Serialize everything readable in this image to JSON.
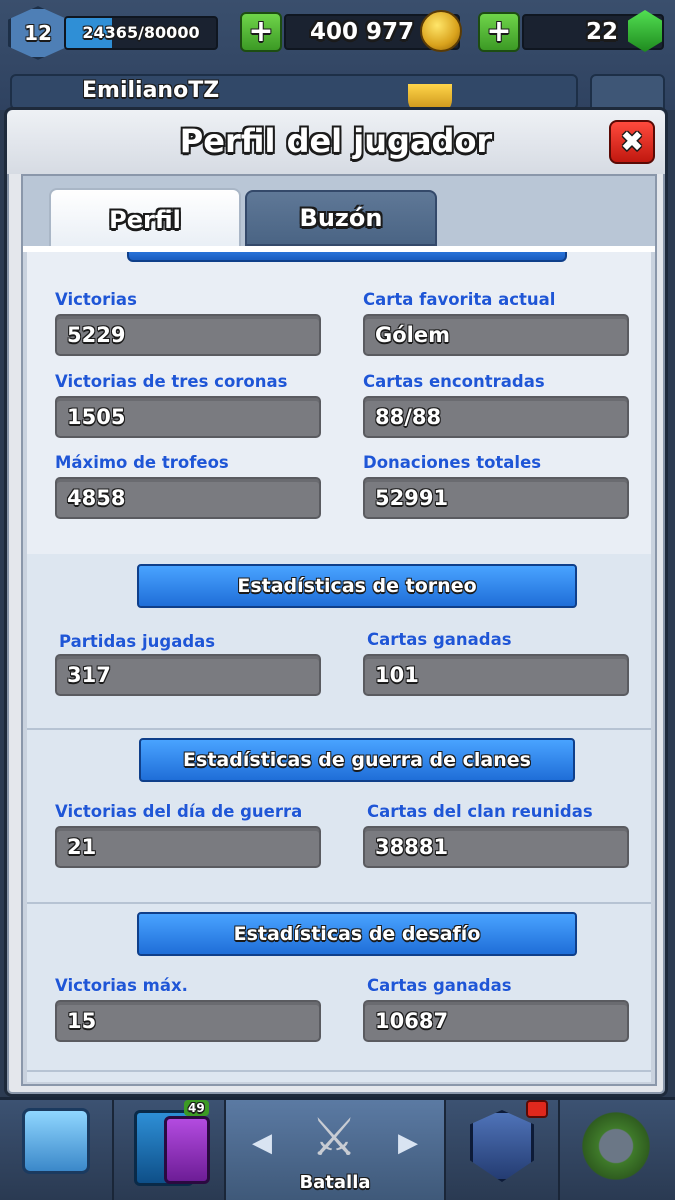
{
  "hud": {
    "level": "12",
    "xp": "24365/80000",
    "xp_progress": 0.3046,
    "gold": "400 977",
    "gems": "22",
    "player_name": "EmilianoTZ"
  },
  "modal": {
    "title": "Perfil del jugador",
    "close": "✖",
    "tabs": [
      "Perfil",
      "Buzón"
    ]
  },
  "profile_stats": [
    {
      "label": "Victorias",
      "value": "5229"
    },
    {
      "label": "Carta favorita actual",
      "value": "Gólem"
    },
    {
      "label": "Victorias de tres coronas",
      "value": "1505"
    },
    {
      "label": "Cartas encontradas",
      "value": "88/88"
    },
    {
      "label": "Máximo de trofeos",
      "value": "4858"
    },
    {
      "label": "Donaciones totales",
      "value": "52991"
    }
  ],
  "tournament": {
    "title": "Estadísticas de torneo",
    "stats": [
      {
        "label": "Partidas jugadas",
        "value": "317"
      },
      {
        "label": "Cartas ganadas",
        "value": "101"
      }
    ]
  },
  "clan_war": {
    "title": "Estadísticas de guerra de clanes",
    "stats": [
      {
        "label": "Victorias del día de guerra",
        "value": "21"
      },
      {
        "label": "Cartas del clan reunidas",
        "value": "38881"
      }
    ]
  },
  "challenge": {
    "title": "Estadísticas de desafío",
    "stats": [
      {
        "label": "Victorias máx.",
        "value": "15"
      },
      {
        "label": "Cartas ganadas",
        "value": "10687"
      }
    ]
  },
  "nav": {
    "battle_label": "Batalla",
    "cards_badge": "49"
  },
  "colors": {
    "stat_label": "#1f56d6",
    "stat_box": "#7a7b80",
    "banner": "#2f7ee6",
    "plus_button": "#4fbf32",
    "close_button": "#e0281d"
  },
  "icons": [
    "gold-coin-icon",
    "gem-icon",
    "plus-icon",
    "trophy-icon",
    "gear-icon",
    "close-icon",
    "chest-icon",
    "cards-icon",
    "crossed-swords-icon",
    "clan-shield-icon",
    "tournament-icon"
  ]
}
